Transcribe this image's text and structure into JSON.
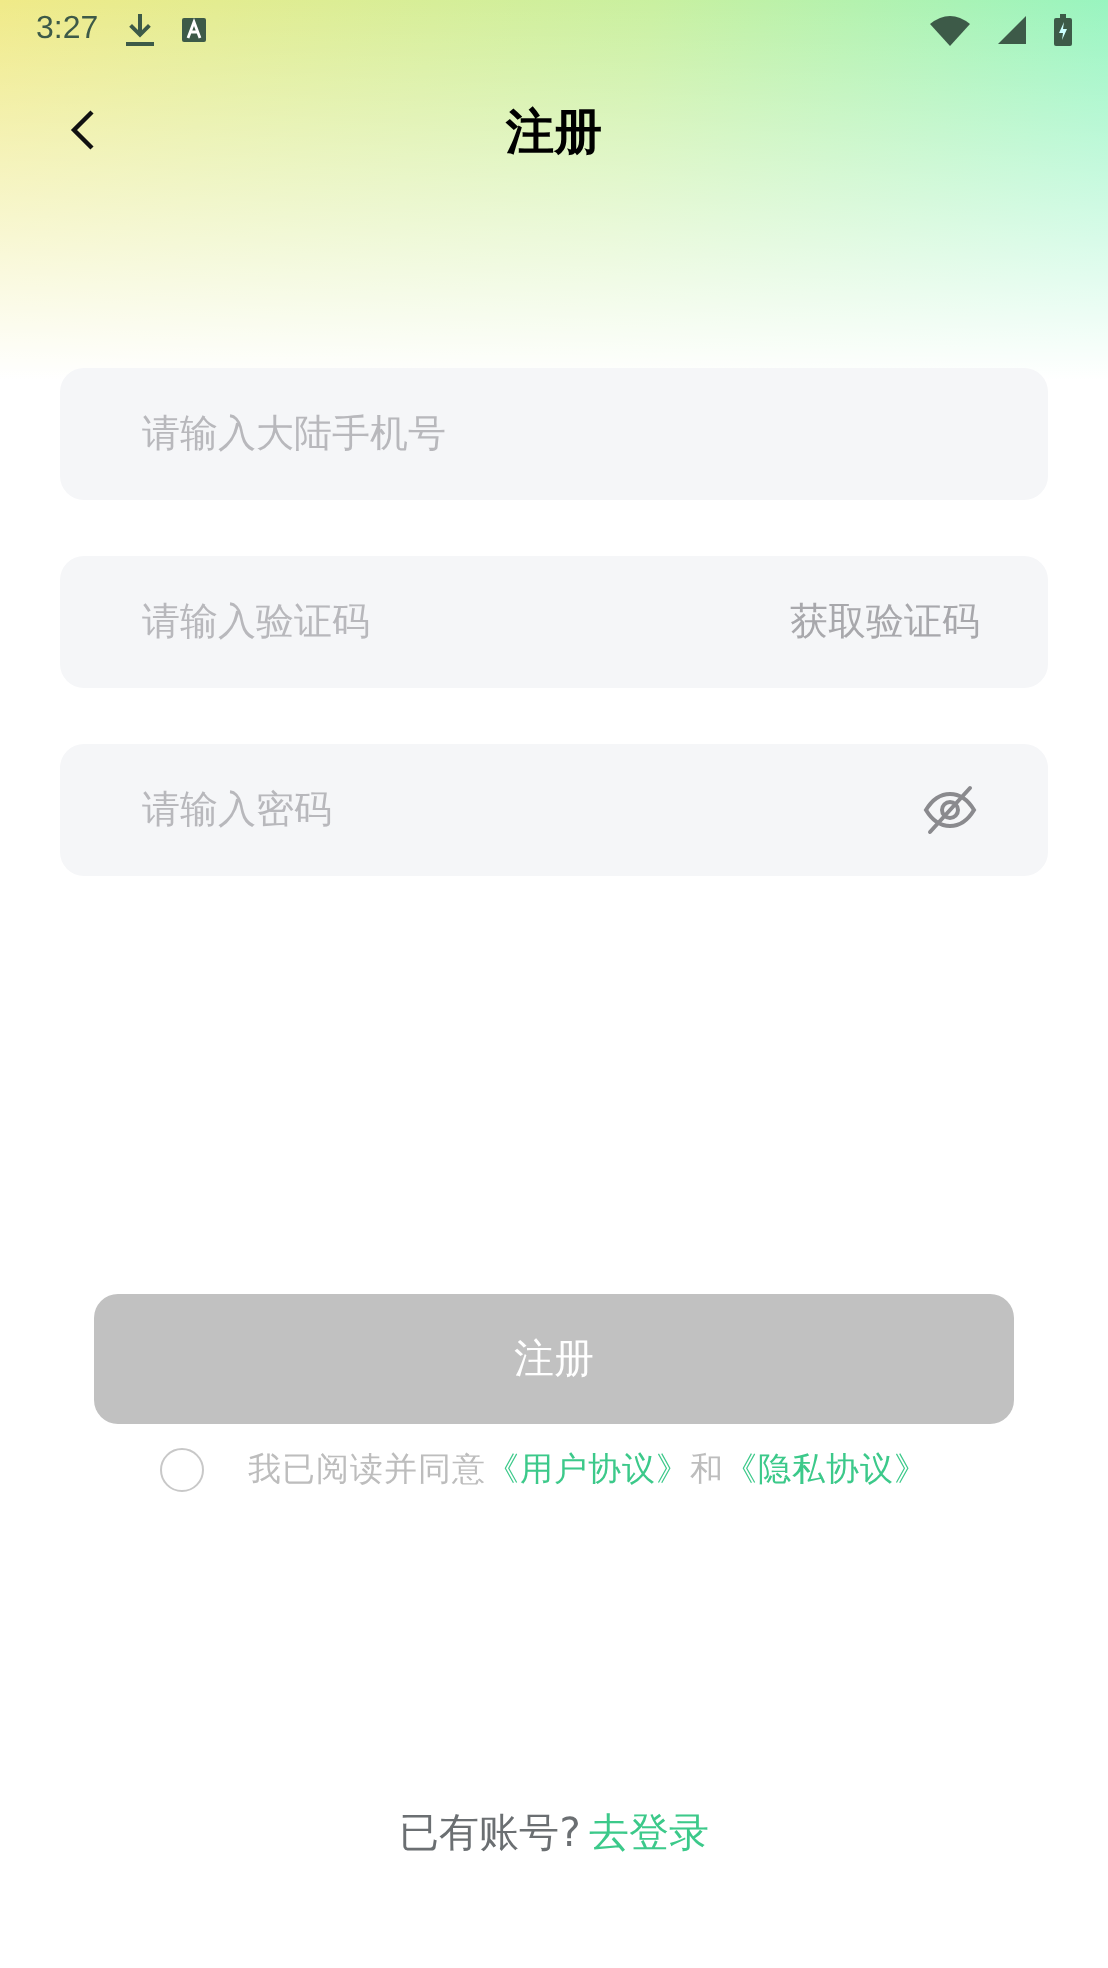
{
  "status_bar": {
    "time": "3:27"
  },
  "header": {
    "title": "注册"
  },
  "fields": [
    {
      "kind": "plain",
      "placeholder": "请输入大陆手机号"
    },
    {
      "kind": "code",
      "placeholder": "请输入验证码",
      "action": "获取验证码"
    },
    {
      "kind": "password",
      "placeholder": "请输入密码"
    }
  ],
  "submit": {
    "label": "注册",
    "disabled": true
  },
  "agreement": {
    "checked": false,
    "prefix": "我已阅读并同意",
    "link1": "《用户协议》",
    "joiner": "和",
    "link2": "《隐私协议》"
  },
  "footer": {
    "prompt": "已有账号?",
    "link": "去登录"
  }
}
